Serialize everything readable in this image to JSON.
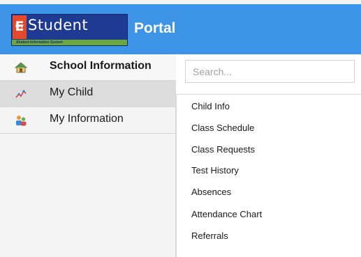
{
  "header": {
    "logo": {
      "badge": "E",
      "badge_small": "my",
      "word": "Student",
      "tagline": "Student Information System"
    },
    "portal_title": "Portal",
    "colors": {
      "header_bg": "#3d94e6",
      "logo_bg": "#1f3a93",
      "badge": "#e24a2b",
      "strip": "#6ba93f"
    }
  },
  "sidebar": {
    "items": [
      {
        "label": "School Information",
        "icon": "school-house-icon",
        "state": "active"
      },
      {
        "label": "My Child",
        "icon": "child-chart-icon",
        "state": "hover"
      },
      {
        "label": "My Information",
        "icon": "users-icon",
        "state": "normal"
      }
    ]
  },
  "panel": {
    "search": {
      "placeholder": "Search...",
      "value": ""
    },
    "menu": [
      "Child Info",
      "Class Schedule",
      "Class Requests",
      "Test History",
      "Absences",
      "Attendance Chart",
      "Referrals"
    ]
  }
}
